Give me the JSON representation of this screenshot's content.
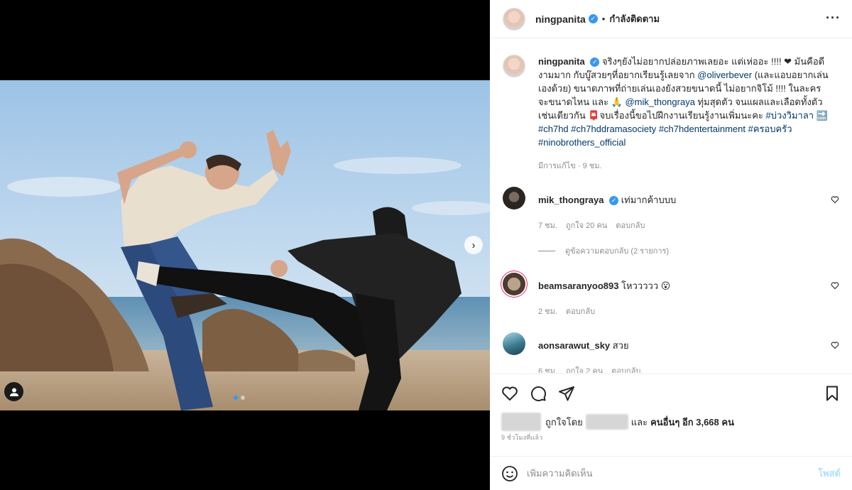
{
  "header": {
    "username": "ningpanita",
    "dot": "•",
    "follow_status": "กำลังติดตาม",
    "more": "···"
  },
  "caption": {
    "username": "ningpanita",
    "part1": "จริงๆยังไม่อยากปล่อยภาพเลยอะ แต่เห่ออะ !!!! ❤ มันคือดีงามมาก กับบู๊สวยๆที่อยากเรียนรู้เลยจาก ",
    "mention1": "@oliverbever",
    "part2": " (และแอบอยากเล่นเองด้วย) ขนาดภาพที่ถ่ายเล่นเองยังสวยขนาดนี้ ไม่อยากจิโม้ !!!! ในละครจะขนาดไหน และ 🙏 ",
    "mention2": "@mik_thongraya",
    "part3": " ทุ่มสุดตัว จนแผลและเลือดทั้งตัวเช่นเดียวกัน 📮จบเรื่องนี้ขอไปฝึกงานเรียนรู้งานเพิ่มนะคะ ",
    "tags": "#บ่วงวิมาลา 🔜 #ch7hd #ch7hddramasociety #ch7hdentertainment #ครอบครัว #ninobrothers_official",
    "meta": "มีการแก้ไข · 9 ชม."
  },
  "comments": [
    {
      "username": "mik_thongraya",
      "verified": true,
      "text": "เท่มากค้าบบบ",
      "time": "7 ชม.",
      "likes": "ถูกใจ 20 คน",
      "reply": "ตอบกลับ",
      "view_replies": "ดูข้อความตอบกลับ (2 รายการ)"
    },
    {
      "username": "beamsaranyoo893",
      "verified": false,
      "text": "โหววววว 😮",
      "time": "2 ชม.",
      "likes": "",
      "reply": "ตอบกลับ"
    },
    {
      "username": "aonsarawut_sky",
      "verified": false,
      "text": "สวย",
      "time": "6 ชม.",
      "likes": "ถูกใจ 2 คน",
      "reply": "ตอบกลับ"
    }
  ],
  "likes": {
    "prefix": "ถูกใจโดย",
    "middle": "และ",
    "others_label": "คนอื่นๆ อีก 3,668 คน"
  },
  "timestamp": "9 ชั่วโมงที่แล้ว",
  "composer": {
    "placeholder": "เพิ่มความคิดเห็น",
    "post_label": "โพสต์"
  },
  "colors": {
    "verified": "#3897f0",
    "link": "#00376b",
    "muted": "#8e8e8e",
    "post_disabled": "#b2dffc"
  }
}
